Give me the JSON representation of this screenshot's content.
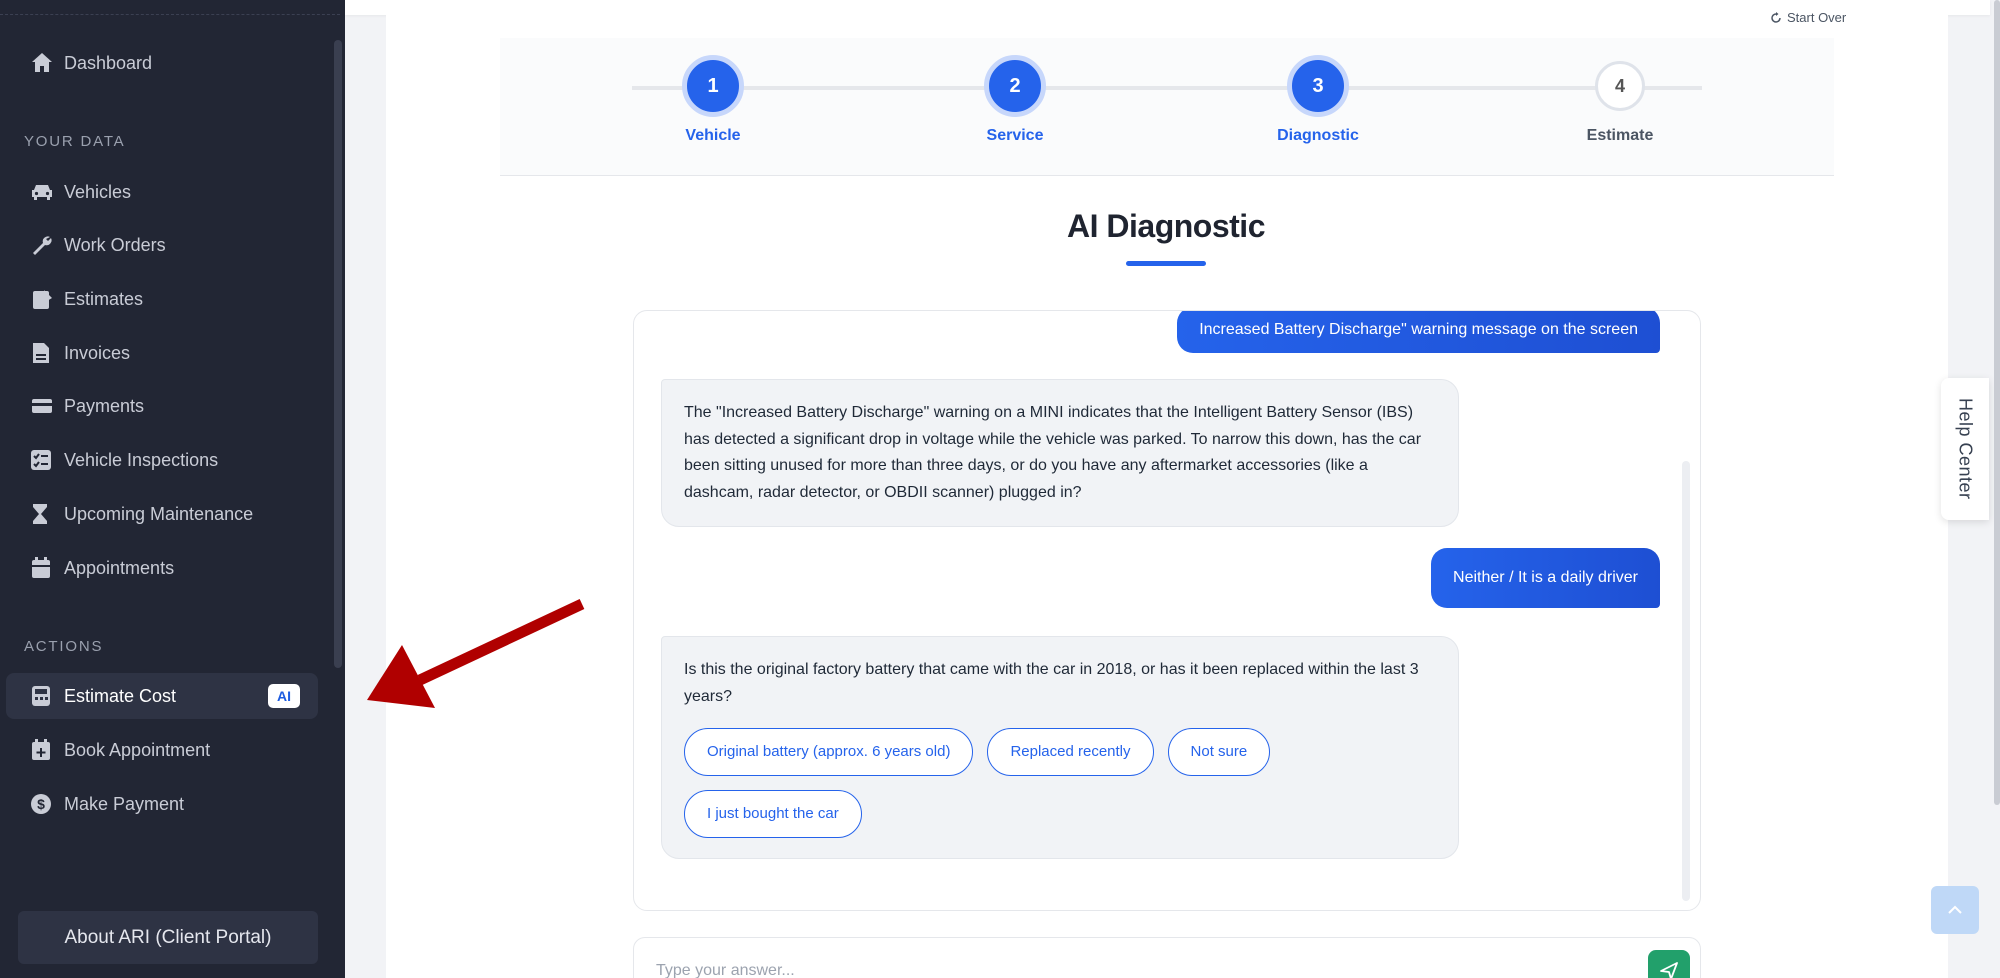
{
  "sidebar": {
    "dashboard": "Dashboard",
    "section_data": "YOUR DATA",
    "vehicles": "Vehicles",
    "work_orders": "Work Orders",
    "estimates": "Estimates",
    "invoices": "Invoices",
    "payments": "Payments",
    "vehicle_inspections": "Vehicle Inspections",
    "upcoming_maintenance": "Upcoming Maintenance",
    "appointments": "Appointments",
    "section_actions": "ACTIONS",
    "estimate_cost": "Estimate Cost",
    "ai_badge": "AI",
    "book_appointment": "Book Appointment",
    "make_payment": "Make Payment",
    "about": "About ARI (Client Portal)"
  },
  "header": {
    "start_over": "Start Over"
  },
  "stepper": {
    "steps": [
      {
        "number": "1",
        "label": "Vehicle",
        "state": "done"
      },
      {
        "number": "2",
        "label": "Service",
        "state": "done"
      },
      {
        "number": "3",
        "label": "Diagnostic",
        "state": "active"
      },
      {
        "number": "4",
        "label": "Estimate",
        "state": "todo"
      }
    ]
  },
  "page": {
    "title": "AI Diagnostic"
  },
  "chat": {
    "msg1_user": "Increased Battery Discharge\" warning message on the screen",
    "msg2_ai": "The \"Increased Battery Discharge\" warning on a MINI indicates that the Intelligent Battery Sensor (IBS) has detected a significant drop in voltage while the vehicle was parked. To narrow this down, has the car been sitting unused for more than three days, or do you have any aftermarket accessories (like a dashcam, radar detector, or OBDII scanner) plugged in?",
    "msg3_user": "Neither / It is a daily driver",
    "msg4_ai": "Is this the original factory battery that came with the car in 2018, or has it been replaced within the last 3 years?",
    "options": [
      "Original battery (approx. 6 years old)",
      "Replaced recently",
      "Not sure",
      "I just bought the car"
    ]
  },
  "input": {
    "placeholder": "Type your answer..."
  },
  "help": {
    "label": "Help Center"
  },
  "colors": {
    "primary": "#2563eb",
    "sidebar_bg": "#222634",
    "send": "#22a06b",
    "arrow": "#b00000"
  }
}
